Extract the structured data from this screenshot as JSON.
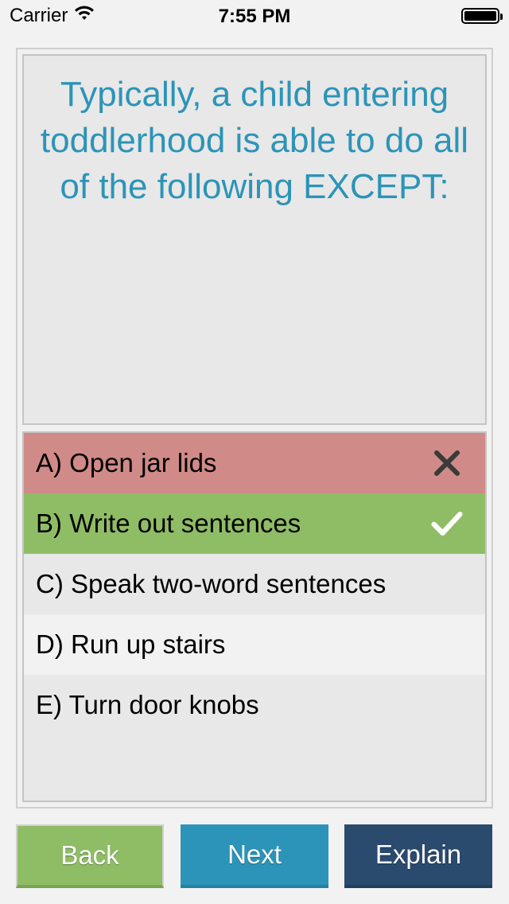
{
  "status_bar": {
    "carrier": "Carrier",
    "time": "7:55 PM"
  },
  "question": {
    "text": "Typically, a child entering toddlerhood is able to do all of the following EXCEPT:"
  },
  "answers": [
    {
      "label": "A) Open jar lids",
      "state": "wrong",
      "mark": "close-icon"
    },
    {
      "label": "B) Write out sentences",
      "state": "correct",
      "mark": "checkmark-icon"
    },
    {
      "label": "C) Speak two-word sentences",
      "state": "neutral"
    },
    {
      "label": "D) Run up stairs",
      "state": "neutral"
    },
    {
      "label": "E) Turn door knobs",
      "state": "neutral"
    }
  ],
  "buttons": {
    "back": "Back",
    "next": "Next",
    "explain": "Explain"
  },
  "colors": {
    "accent_blue": "#2c94b8",
    "wrong_red": "#d08a87",
    "correct_green": "#8fbd66",
    "explain_navy": "#2a4a6e"
  }
}
